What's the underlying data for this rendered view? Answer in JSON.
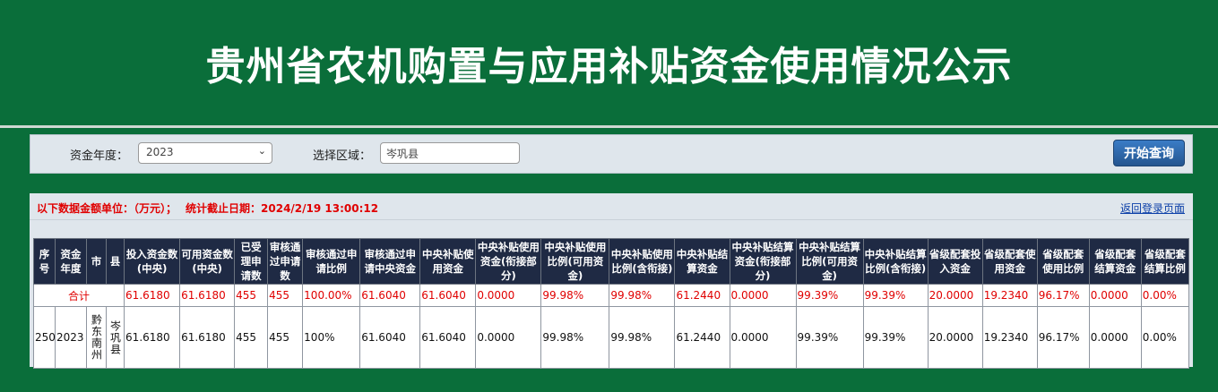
{
  "header": {
    "title": "贵州省农机购置与应用补贴资金使用情况公示"
  },
  "filter": {
    "year_label": "资金年度：",
    "year_value": "2023",
    "region_label": "选择区域：",
    "region_value": "岑巩县",
    "query_button": "开始查询"
  },
  "notice": {
    "unit": "以下数据金额单位：（万元）；",
    "date": "统计截止日期：2024/2/19 13:00:12",
    "back_link": "返回登录页面"
  },
  "table": {
    "headers": [
      "序号",
      "资金年度",
      "市",
      "县",
      "投入资金数(中央)",
      "可用资金数(中央)",
      "已受理申请数",
      "审核通过申请数",
      "审核通过申请比例",
      "审核通过申请中央资金",
      "中央补贴使用资金",
      "中央补贴使用资金(衔接部分)",
      "中央补贴使用比例(可用资金)",
      "中央补贴使用比例(含衔接)",
      "中央补贴结算资金",
      "中央补贴结算资金(衔接部分)",
      "中央补贴结算比例(可用资金)",
      "中央补贴结算比例(含衔接)",
      "省级配套投入资金",
      "省级配套使用资金",
      "省级配套使用比例",
      "省级配套结算资金",
      "省级配套结算比例"
    ],
    "total": {
      "label": "合计",
      "cells": [
        "61.6180",
        "61.6180",
        "455",
        "455",
        "100.00%",
        "61.6040",
        "61.6040",
        "0.0000",
        "99.98%",
        "99.98%",
        "61.2440",
        "0.0000",
        "99.39%",
        "99.39%",
        "20.0000",
        "19.2340",
        "96.17%",
        "0.0000",
        "0.00%"
      ]
    },
    "rows": [
      {
        "index": "250",
        "year": "2023",
        "city": "黔东南州",
        "county": "岑巩县",
        "cells": [
          "61.6180",
          "61.6180",
          "455",
          "455",
          "100%",
          "61.6040",
          "61.6040",
          "0.0000",
          "99.98%",
          "99.98%",
          "61.2440",
          "0.0000",
          "99.39%",
          "99.39%",
          "20.0000",
          "19.2340",
          "96.17%",
          "0.0000",
          "0.00%"
        ]
      }
    ]
  }
}
